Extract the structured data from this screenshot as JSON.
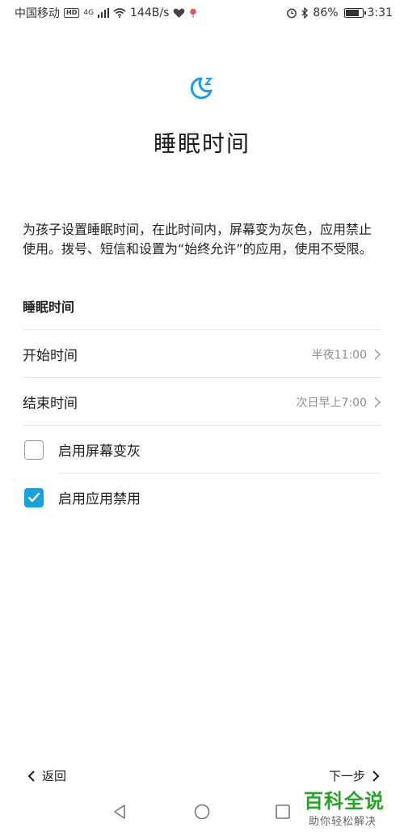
{
  "status_bar": {
    "carrier": "中国移动",
    "hd_badge": "HD",
    "network": "4G",
    "speed": "144B/s",
    "battery_percent": "86%",
    "battery_level": 0.86,
    "time": "3:31"
  },
  "header": {
    "icon": "moon-sleep-icon",
    "title": "睡眠时间"
  },
  "description": "为孩子设置睡眠时间，在此时间内，屏幕变为灰色，应用禁止使用。拨号、短信和设置为“始终允许”的应用，使用不受限。",
  "section": {
    "header": "睡眠时间"
  },
  "rows": {
    "start": {
      "label": "开始时间",
      "value": "半夜11:00"
    },
    "end": {
      "label": "结束时间",
      "value": "次日早上7:00"
    }
  },
  "options": {
    "gray_screen": {
      "label": "启用屏幕变灰",
      "checked": false
    },
    "app_block": {
      "label": "启用应用禁用",
      "checked": true
    }
  },
  "footer": {
    "back_label": "返回",
    "next_label": "下一步"
  },
  "watermark": {
    "title": "百科全说",
    "subtitle": "助你轻松解决"
  },
  "colors": {
    "accent": "#1a9fdf",
    "watermark_green": "#2aa22a"
  }
}
